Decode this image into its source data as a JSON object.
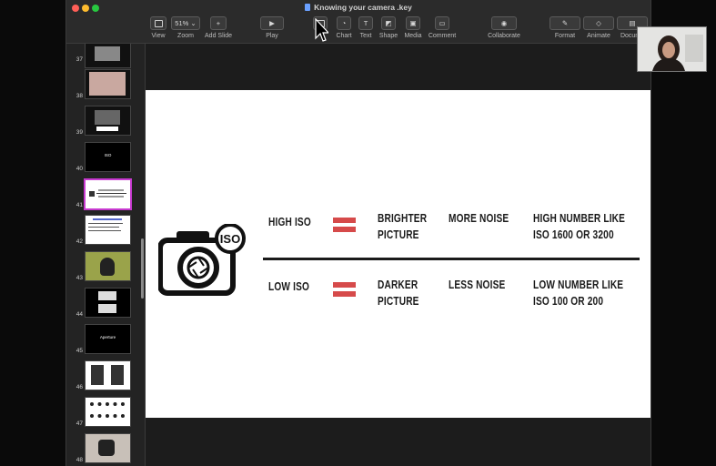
{
  "window": {
    "title": "Knowing your camera .key"
  },
  "toolbar": {
    "zoom_value": "51%",
    "items": [
      {
        "label": "View"
      },
      {
        "label": "Zoom"
      },
      {
        "label": "Add Slide"
      },
      {
        "label": "Play"
      },
      {
        "label": "Table"
      },
      {
        "label": "Chart"
      },
      {
        "label": "Text"
      },
      {
        "label": "Shape"
      },
      {
        "label": "Media"
      },
      {
        "label": "Comment"
      },
      {
        "label": "Collaborate"
      },
      {
        "label": "Format"
      },
      {
        "label": "Animate"
      },
      {
        "label": "Docume"
      }
    ]
  },
  "sidebar": {
    "slides": [
      {
        "number": "37"
      },
      {
        "number": "38"
      },
      {
        "number": "39"
      },
      {
        "number": "40",
        "text": "ISO"
      },
      {
        "number": "41",
        "selected": true
      },
      {
        "number": "42"
      },
      {
        "number": "43"
      },
      {
        "number": "44"
      },
      {
        "number": "45",
        "text": "Aperture"
      },
      {
        "number": "46"
      },
      {
        "number": "47"
      },
      {
        "number": "48"
      }
    ]
  },
  "slide": {
    "camera_badge": "ISO",
    "row1": {
      "label": "HIGH ISO",
      "result_line1": "BRIGHTER",
      "result_line2": "PICTURE",
      "noise": "MORE NOISE",
      "number_line1": "HIGH NUMBER LIKE",
      "number_line2": "ISO 1600 OR 3200"
    },
    "row2": {
      "label": "LOW ISO",
      "result_line1": "DARKER",
      "result_line2": "PICTURE",
      "noise": "LESS NOISE",
      "number_line1": "LOW NUMBER LIKE",
      "number_line2": "ISO 100 OR 200"
    },
    "accent_color": "#d64a4a"
  },
  "icons": [
    "table-icon",
    "chart-icon",
    "text-icon",
    "shape-icon",
    "media-icon",
    "comment-icon",
    "collaborate-icon",
    "format-icon",
    "animate-icon",
    "document-icon",
    "camera-icon",
    "cursor-icon"
  ]
}
